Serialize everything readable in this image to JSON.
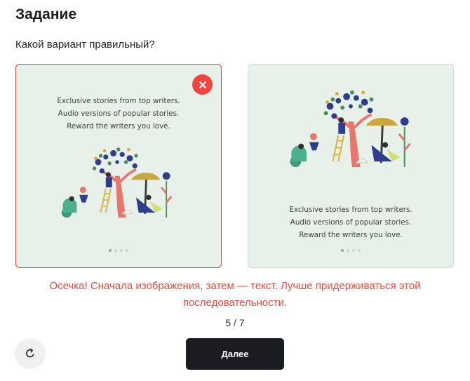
{
  "header": {
    "title": "Задание"
  },
  "question": "Какой вариант правильный?",
  "options": [
    {
      "state": "wrong",
      "badge_icon": "close-icon",
      "lines": [
        "Exclusive stories from top writers.",
        "Audio versions of popular stories.",
        "Reward the writers you love."
      ]
    },
    {
      "state": "neutral",
      "lines": [
        "Exclusive stories from top writers.",
        "Audio versions of popular stories.",
        "Reward the writers you love."
      ]
    }
  ],
  "feedback": {
    "line1": "Осечка! Сначала изображения, затем — текст. Лучше придерживаться этой",
    "line2": "последовательности.",
    "color": "#e84a3f"
  },
  "progress": "5 / 7",
  "buttons": {
    "retry_icon": "refresh-icon",
    "next_label": "Далее"
  }
}
